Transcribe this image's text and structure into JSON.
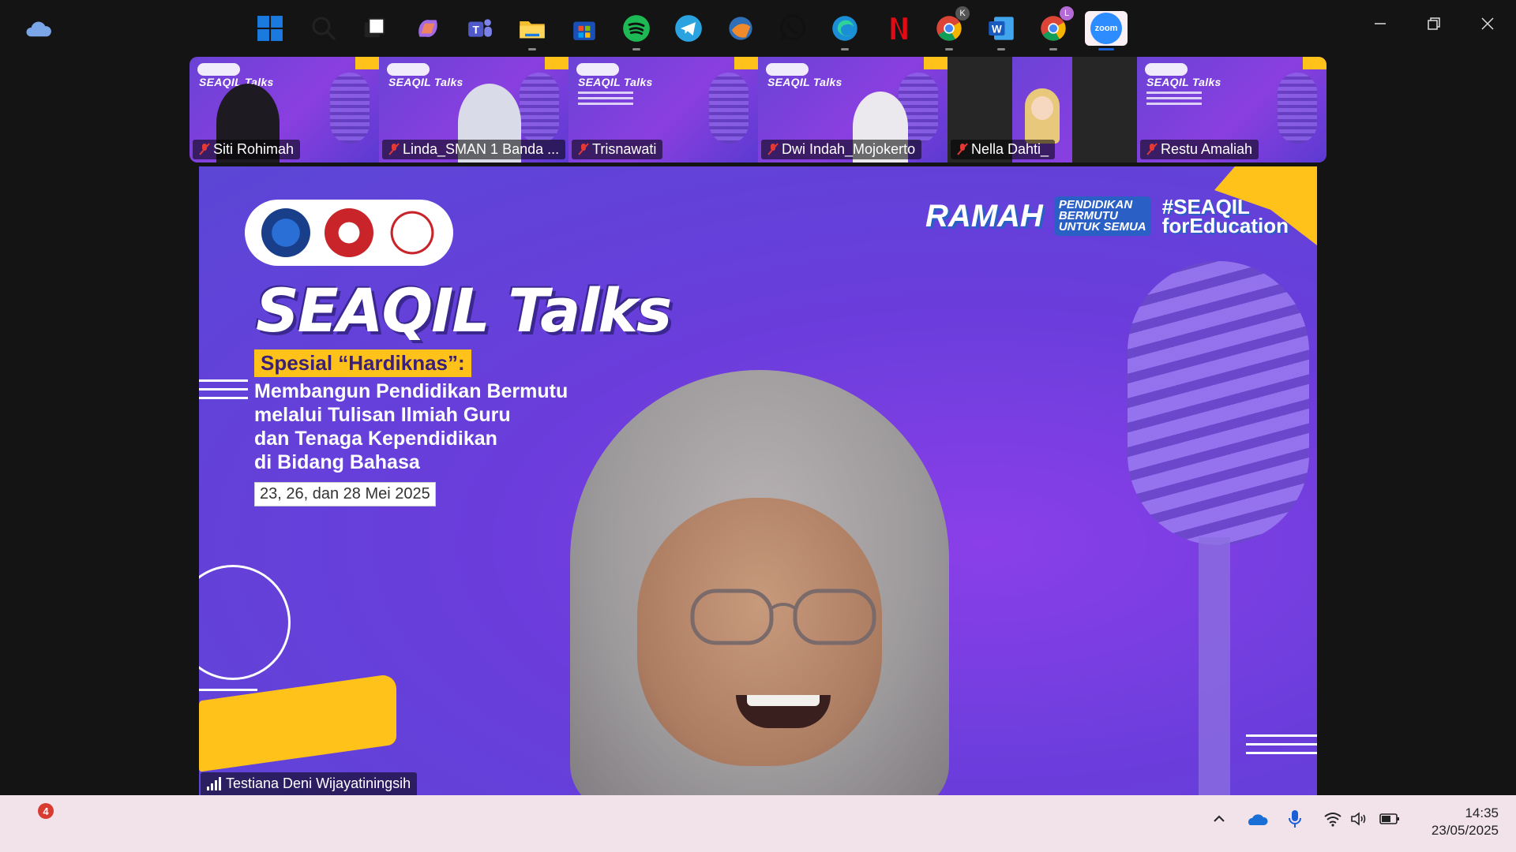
{
  "window": {
    "controls": [
      "minimize",
      "restore",
      "close"
    ]
  },
  "participants": [
    {
      "name": "Siti Rohimah",
      "muted": true
    },
    {
      "name": "Linda_SMAN 1 Banda ...",
      "muted": true
    },
    {
      "name": "Trisnawati",
      "muted": true
    },
    {
      "name": "Dwi Indah_Mojokerto",
      "muted": true
    },
    {
      "name": "Nella Dahti_",
      "muted": true
    },
    {
      "name": "Restu Amaliah",
      "muted": true
    }
  ],
  "tile_title": "SEAQIL Talks",
  "main_video": {
    "speaker_name": "Testiana Deni Wijayatiningsih",
    "slide": {
      "title": "SEAQIL Talks",
      "special_label": "Spesial “Hardiknas”:",
      "subtitle_lines": [
        "Membangun Pendidikan Bermutu",
        "melalui Tulisan Ilmiah Guru",
        "dan Tenaga Kependidikan",
        "di Bidang Bahasa"
      ],
      "date": "23, 26, dan 28 Mei 2025",
      "ramah": "RAMAH",
      "hashtag1_lines": [
        "PENDIDIKAN",
        "BERMUTU",
        "UNTUK SEMUA"
      ],
      "hashtag2_lines": [
        "#SEAQIL",
        "forEducation"
      ]
    }
  },
  "taskbar": {
    "weather_badge": "4",
    "apps": [
      "start",
      "search",
      "task-view",
      "copilot",
      "teams",
      "file-explorer",
      "microsoft-store",
      "spotify",
      "telegram",
      "app-extra",
      "whatsapp",
      "edge",
      "netflix",
      "chrome-k",
      "word",
      "chrome-l",
      "zoom"
    ],
    "chrome_k_badge": "K",
    "chrome_l_badge": "L",
    "zoom_label": "zoom",
    "clock_time": "14:35",
    "clock_date": "23/05/2025"
  },
  "colors": {
    "purple": "#6a42d6",
    "yellow": "#ffc21a",
    "taskbar": "#f2e3ea",
    "muted_red": "#e53935"
  }
}
